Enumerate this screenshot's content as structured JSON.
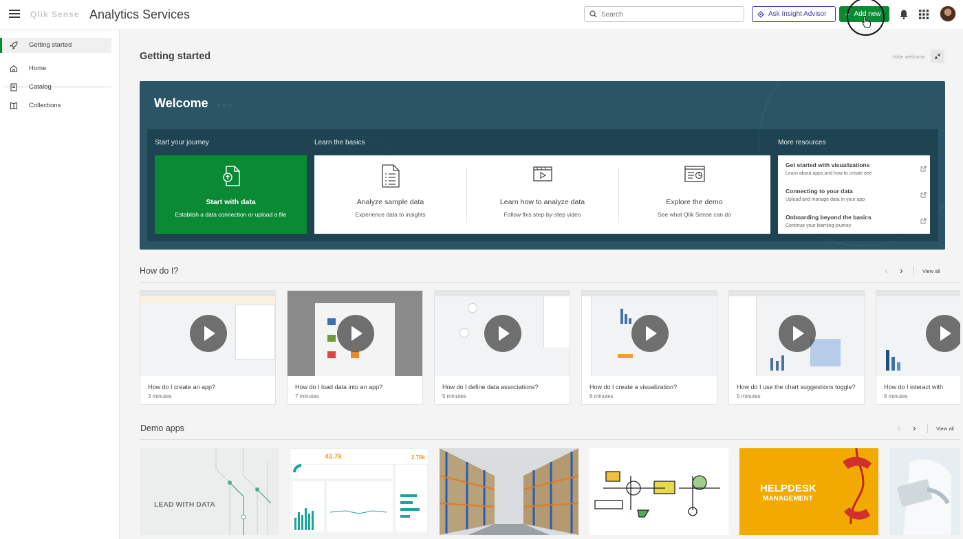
{
  "header": {
    "logo_text": "Qlik Sense",
    "app_title": "Analytics Services",
    "search_placeholder": "Search",
    "ask_label": "Ask Insight Advisor",
    "add_label": "Add new"
  },
  "sidebar": {
    "items": [
      {
        "label": "Getting started",
        "icon": "rocket-icon"
      },
      {
        "label": "Home",
        "icon": "home-icon"
      },
      {
        "label": "Catalog",
        "icon": "catalog-icon"
      },
      {
        "label": "Collections",
        "icon": "bookmark-icon"
      }
    ]
  },
  "main": {
    "title": "Getting started",
    "hide_welcome": "Hide welcome"
  },
  "welcome": {
    "title": "Welcome",
    "journey_heading": "Start your journey",
    "basics_heading": "Learn the basics",
    "resources_heading": "More resources",
    "start": {
      "title": "Start with data",
      "subtitle": "Establish a data connection or upload a file"
    },
    "basics": [
      {
        "title": "Analyze sample data",
        "subtitle": "Experience data to insights"
      },
      {
        "title": "Learn how to analyze data",
        "subtitle": "Follow this step-by-step video"
      },
      {
        "title": "Explore the demo",
        "subtitle": "See what Qlik Sense can do"
      }
    ],
    "resources": [
      {
        "title": "Get started with visualizations",
        "subtitle": "Learn about apps and how to create one"
      },
      {
        "title": "Connecting to your data",
        "subtitle": "Upload and manage data in your app"
      },
      {
        "title": "Onboarding beyond the basics",
        "subtitle": "Continue your learning journey"
      }
    ]
  },
  "how_do_i": {
    "title": "How do I?",
    "view_all": "View all",
    "videos": [
      {
        "title": "How do I create an app?",
        "duration": "3 minutes"
      },
      {
        "title": "How do I load data into an app?",
        "duration": "7 minutes"
      },
      {
        "title": "How do I define data associations?",
        "duration": "5 minutes"
      },
      {
        "title": "How do I create a visualization?",
        "duration": "6 minutes"
      },
      {
        "title": "How do I use the chart suggestions toggle?",
        "duration": "5 minutes"
      },
      {
        "title": "How do I interact with",
        "duration": "6 minutes"
      }
    ]
  },
  "demo_apps": {
    "title": "Demo apps",
    "view_all": "View all",
    "lead_text": "LEAD WITH DATA",
    "helpdesk_line1": "HELPDESK",
    "helpdesk_line2": "MANAGEMENT",
    "kpi_value": "43.7k",
    "kpi_value2": "2.78k"
  },
  "colors": {
    "brand_green": "#0b8a36",
    "welcome_bg": "#2b5565",
    "ask_blue": "#3b3f9e",
    "helpdesk_orange": "#f2a900"
  }
}
